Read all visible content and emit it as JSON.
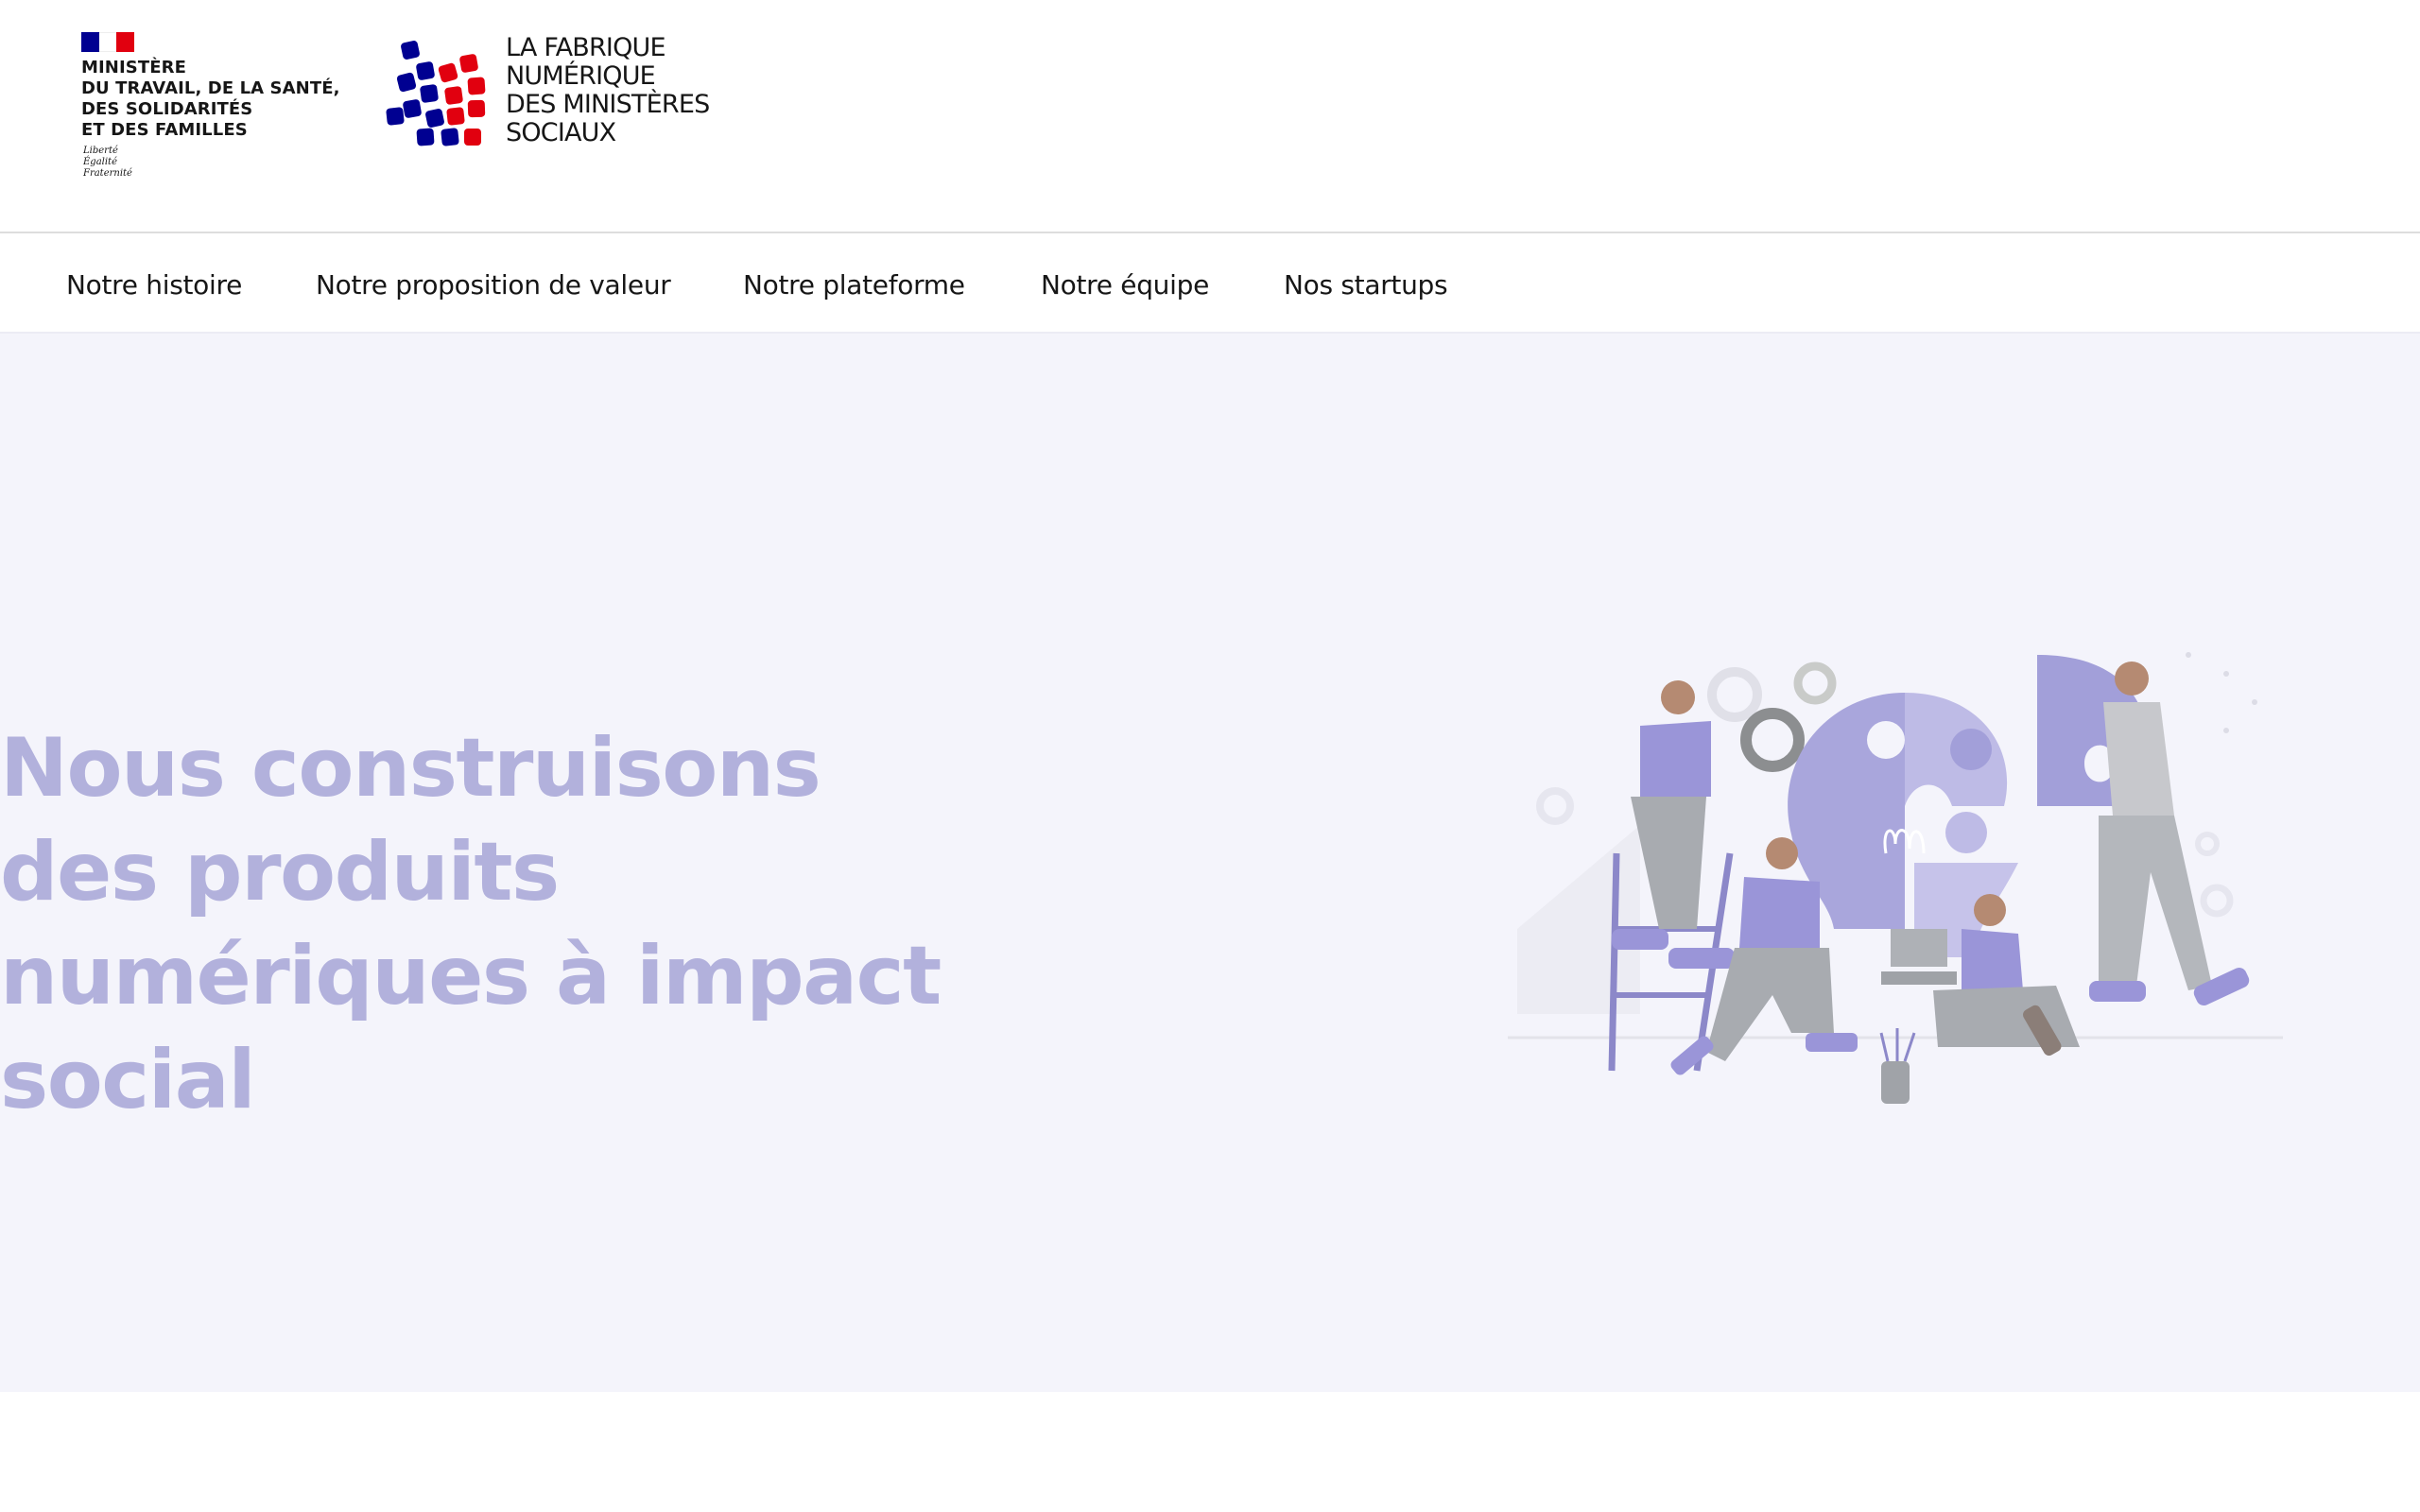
{
  "header": {
    "ministry": {
      "name": "MINISTÈRE\nDU TRAVAIL, DE LA SANTÉ,\nDES SOLIDARITÉS\nET DES FAMILLES",
      "devise": "Liberté\nÉgalité\nFraternité",
      "flag_colors": [
        "#000091",
        "#ffffff",
        "#e1000f"
      ]
    },
    "fabrique": {
      "name": "LA FABRIQUE\nNUMÉRIQUE\nDES MINISTÈRES\nSOCIAUX",
      "logo_icon": "fabrique-squares-logo",
      "logo_colors": [
        "#000091",
        "#e1000f"
      ]
    }
  },
  "nav": {
    "items": [
      {
        "label": "Notre histoire"
      },
      {
        "label": "Notre proposition de valeur"
      },
      {
        "label": "Notre plateforme"
      },
      {
        "label": "Notre équipe"
      },
      {
        "label": "Nos startups"
      }
    ]
  },
  "hero": {
    "title": "Nous construisons des produits numériques à impact social",
    "illustration_icon": "team-building-lightbulb-puzzle-illustration",
    "accent_color": "#8b85d6",
    "background_color": "#f4f4fb"
  }
}
